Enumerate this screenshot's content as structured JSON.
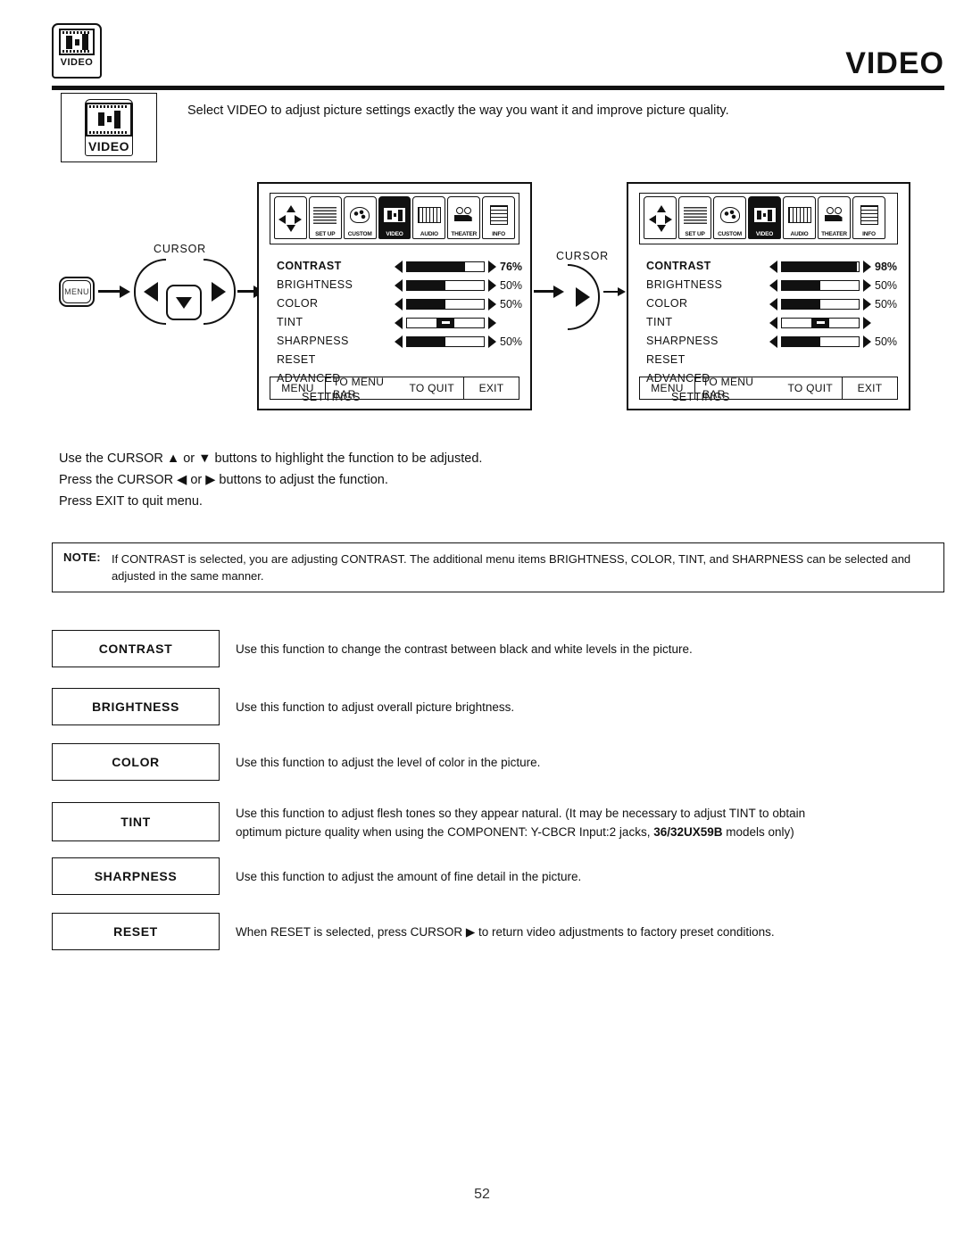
{
  "header": {
    "title": "VIDEO",
    "icon_label": "VIDEO",
    "icon_name": "video-tab-icon"
  },
  "intro": {
    "icon_label": "VIDEO",
    "text": "Select VIDEO to adjust picture settings exactly the way you want it and improve picture quality."
  },
  "diagram": {
    "cursor_label_left": "CURSOR",
    "cursor_label_middle": "CURSOR",
    "menu_button_label": "MENU"
  },
  "osd_menus": [
    {
      "id": "osd-before",
      "iconbar": [
        {
          "label": "",
          "icon": "cursor-pad-icon",
          "selected": false
        },
        {
          "label": "SET UP",
          "icon": "setup-icon",
          "selected": false
        },
        {
          "label": "CUSTOM",
          "icon": "custom-palette-icon",
          "selected": false
        },
        {
          "label": "VIDEO",
          "icon": "video-icon",
          "selected": true
        },
        {
          "label": "AUDIO",
          "icon": "audio-keys-icon",
          "selected": false
        },
        {
          "label": "THEATER",
          "icon": "theater-camera-icon",
          "selected": false
        },
        {
          "label": "INFO",
          "icon": "info-doc-icon",
          "selected": false
        }
      ],
      "items": [
        {
          "label": "CONTRAST",
          "selected": true,
          "has_slider": true,
          "fill_pct": 76,
          "value": "76%",
          "type": "fill"
        },
        {
          "label": "BRIGHTNESS",
          "selected": false,
          "has_slider": true,
          "fill_pct": 50,
          "value": "50%",
          "type": "fill"
        },
        {
          "label": "COLOR",
          "selected": false,
          "has_slider": true,
          "fill_pct": 50,
          "value": "50%",
          "type": "fill"
        },
        {
          "label": "TINT",
          "selected": false,
          "has_slider": true,
          "fill_pct": 50,
          "value": "",
          "type": "notch"
        },
        {
          "label": "SHARPNESS",
          "selected": false,
          "has_slider": true,
          "fill_pct": 50,
          "value": "50%",
          "type": "fill"
        },
        {
          "label": "RESET",
          "selected": false,
          "has_slider": false,
          "fill_pct": 0,
          "value": "",
          "type": "none"
        },
        {
          "label": "ADVANCED",
          "selected": false,
          "has_slider": false,
          "fill_pct": 0,
          "value": "",
          "type": "none"
        },
        {
          "label": "SETTINGS",
          "selected": false,
          "has_slider": false,
          "fill_pct": 0,
          "value": "",
          "type": "none",
          "indent": true
        }
      ],
      "footer": {
        "menu": "MENU",
        "to_menu_bar": "TO MENU BAR",
        "to_quit": "TO QUIT",
        "exit": "EXIT"
      }
    },
    {
      "id": "osd-after",
      "iconbar": [
        {
          "label": "",
          "icon": "cursor-pad-icon",
          "selected": false
        },
        {
          "label": "SET UP",
          "icon": "setup-icon",
          "selected": false
        },
        {
          "label": "CUSTOM",
          "icon": "custom-palette-icon",
          "selected": false
        },
        {
          "label": "VIDEO",
          "icon": "video-icon",
          "selected": true
        },
        {
          "label": "AUDIO",
          "icon": "audio-keys-icon",
          "selected": false
        },
        {
          "label": "THEATER",
          "icon": "theater-camera-icon",
          "selected": false
        },
        {
          "label": "INFO",
          "icon": "info-doc-icon",
          "selected": false
        }
      ],
      "items": [
        {
          "label": "CONTRAST",
          "selected": true,
          "has_slider": true,
          "fill_pct": 98,
          "value": "98%",
          "type": "fill"
        },
        {
          "label": "BRIGHTNESS",
          "selected": false,
          "has_slider": true,
          "fill_pct": 50,
          "value": "50%",
          "type": "fill"
        },
        {
          "label": "COLOR",
          "selected": false,
          "has_slider": true,
          "fill_pct": 50,
          "value": "50%",
          "type": "fill"
        },
        {
          "label": "TINT",
          "selected": false,
          "has_slider": true,
          "fill_pct": 50,
          "value": "",
          "type": "notch"
        },
        {
          "label": "SHARPNESS",
          "selected": false,
          "has_slider": true,
          "fill_pct": 50,
          "value": "50%",
          "type": "fill"
        },
        {
          "label": "RESET",
          "selected": false,
          "has_slider": false,
          "fill_pct": 0,
          "value": "",
          "type": "none"
        },
        {
          "label": "ADVANCED",
          "selected": false,
          "has_slider": false,
          "fill_pct": 0,
          "value": "",
          "type": "none"
        },
        {
          "label": "SETTINGS",
          "selected": false,
          "has_slider": false,
          "fill_pct": 0,
          "value": "",
          "type": "none",
          "indent": true
        }
      ],
      "footer": {
        "menu": "MENU",
        "to_menu_bar": "TO MENU BAR",
        "to_quit": "TO QUIT",
        "exit": "EXIT"
      }
    }
  ],
  "instructions": [
    "Use the CURSOR ▲ or ▼ buttons to highlight the function to be adjusted.",
    "Press the CURSOR ◀ or ▶ buttons to adjust the function.",
    "Press EXIT to quit menu."
  ],
  "note": {
    "label": "NOTE:",
    "text": "If CONTRAST is selected, you are adjusting CONTRAST.  The additional menu items BRIGHTNESS, COLOR, TINT, and SHARPNESS can be selected and adjusted in the same manner."
  },
  "functions": [
    {
      "name": "CONTRAST",
      "desc": "Use this function to change the contrast between black and white levels in the picture.",
      "desc2": ""
    },
    {
      "name": "BRIGHTNESS",
      "desc": "Use this function to adjust overall picture brightness.",
      "desc2": ""
    },
    {
      "name": "COLOR",
      "desc": "Use this function to adjust the level of color in the picture.",
      "desc2": ""
    },
    {
      "name": "TINT",
      "desc": "Use this function to adjust flesh tones so they appear natural. (It may be necessary to adjust TINT to obtain",
      "desc2": "optimum picture quality when using the COMPONENT: Y-CBCR Input:2 jacks, 36/32UX59B models only)",
      "desc2_bold": "36/32UX59B"
    },
    {
      "name": "SHARPNESS",
      "desc": "Use this function to adjust the amount of fine detail in the picture.",
      "desc2": ""
    },
    {
      "name": "RESET",
      "desc": "When RESET is selected, press CURSOR ▶ to return video adjustments to factory preset conditions.",
      "desc2": ""
    }
  ],
  "page_number": "52"
}
